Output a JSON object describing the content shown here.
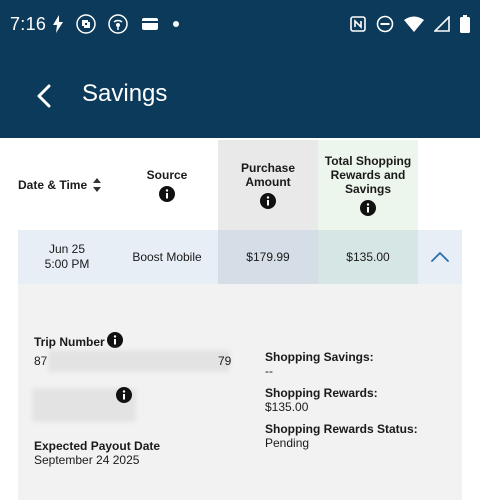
{
  "status_bar": {
    "time": "7:16",
    "left_icons": [
      "flash-icon",
      "chase-app-icon",
      "hotspot-app-icon",
      "wallet-icon",
      "notification-dot-icon"
    ],
    "right_icons": [
      "nfc-icon",
      "do-not-disturb-icon",
      "wifi-icon",
      "signal-icon",
      "battery-icon"
    ]
  },
  "app_bar": {
    "title": "Savings",
    "back_icon": "back-arrow-icon"
  },
  "table": {
    "headers": {
      "date_time": "Date & Time",
      "source": "Source",
      "purchase_amount": "Purchase Amount",
      "total_shopping": "Total Shopping Rewards and Savings"
    },
    "rows": [
      {
        "date": "Jun 25",
        "time": "5:00 PM",
        "source": "Boost Mobile",
        "purchase_amount": "$179.99",
        "total": "$135.00"
      }
    ]
  },
  "detail": {
    "trip_number_label": "Trip Number",
    "trip_number_value_start": "87",
    "trip_number_value_end": "79",
    "payout_label": "Expected Payout Date",
    "payout_value": "September 24 2025",
    "shopping_savings_label": "Shopping Savings:",
    "shopping_savings_value": "--",
    "shopping_rewards_label": "Shopping Rewards:",
    "shopping_rewards_value": "$135.00",
    "rewards_status_label": "Shopping Rewards Status:",
    "rewards_status_value": "Pending"
  },
  "colors": {
    "brand_navy": "#0b3a5a",
    "row_highlight": "#e7eef6",
    "purchase_col": "#e9e9e9",
    "rewards_col": "#edf6ec"
  }
}
